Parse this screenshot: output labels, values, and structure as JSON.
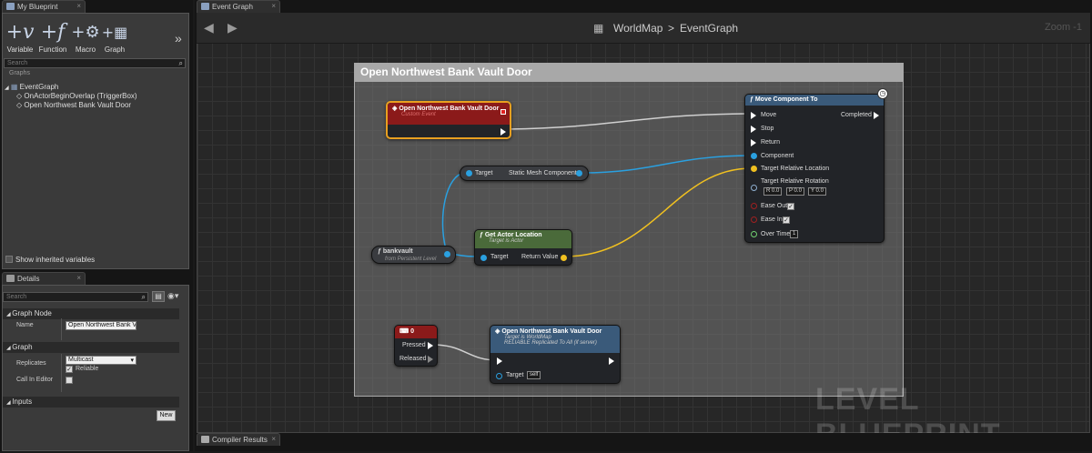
{
  "my_blueprint": {
    "tab_label": "My Blueprint",
    "tools": [
      {
        "label": "Variable",
        "icon": "variable-icon"
      },
      {
        "label": "Function",
        "icon": "function-icon"
      },
      {
        "label": "Macro",
        "icon": "macro-icon"
      },
      {
        "label": "Graph",
        "icon": "graph-icon"
      }
    ],
    "search_placeholder": "Search",
    "graphs_header": "Graphs",
    "tree": {
      "root": "EventGraph",
      "items": [
        "OnActorBeginOverlap (TriggerBox)",
        "Open Northwest Bank Vault Door"
      ]
    },
    "show_inherited": "Show inherited variables"
  },
  "details": {
    "tab_label": "Details",
    "search_placeholder": "Search",
    "graph_node_section": "Graph Node",
    "name_label": "Name",
    "name_value": "Open Northwest Bank Vault Door",
    "graph_section": "Graph",
    "replicates_label": "Replicates",
    "replicates_value": "Multicast",
    "reliable_label": "Reliable",
    "call_in_editor_label": "Call In Editor",
    "inputs_section": "Inputs",
    "new_button": "New"
  },
  "editor": {
    "tab_label": "Event Graph",
    "breadcrumb_root": "WorldMap",
    "breadcrumb_sep": ">",
    "breadcrumb_leaf": "EventGraph",
    "zoom": "Zoom -1",
    "comment": "Open Northwest Bank Vault Door",
    "watermark": "LEVEL BLUEPRINT",
    "bottom_tab": "Compiler Results"
  },
  "nodes": {
    "custom_event": {
      "title": "Open Northwest Bank Vault Door",
      "subtitle": "Custom Event"
    },
    "static_mesh": {
      "target": "Target",
      "output": "Static Mesh Component"
    },
    "bankvault": {
      "title": "bankvault",
      "subtitle": "from Persistent Level"
    },
    "get_location": {
      "title": "Get Actor Location",
      "subtitle": "Target is Actor",
      "target": "Target",
      "return": "Return Value"
    },
    "move_to": {
      "title": "Move Component To",
      "pins": {
        "move": "Move",
        "stop": "Stop",
        "return": "Return",
        "completed": "Completed",
        "component": "Component",
        "loc": "Target Relative Location",
        "rot": "Target Relative Rotation",
        "ease_out": "Ease Out",
        "ease_in": "Ease In",
        "over_time": "Over Time"
      },
      "rot_values": {
        "r": "R 0.0",
        "p": "P 0.0",
        "y": "Y 0.0"
      },
      "over_time_value": "1"
    },
    "key": {
      "title": "0",
      "pressed": "Pressed",
      "released": "Released"
    },
    "call": {
      "title": "Open Northwest Bank Vault Door",
      "sub1": "Target is WorldMap",
      "sub2": "RELIABLE Replicated To All (if server)",
      "target": "Target",
      "self": "self"
    }
  },
  "colors": {
    "event_red": "#8b1a1a",
    "function_green": "#4a6a3a",
    "call_blue": "#3a5a7a",
    "object_pin": "#2aa0e0",
    "vector_pin": "#f0c020",
    "exec_wire": "#d0d0d0"
  }
}
